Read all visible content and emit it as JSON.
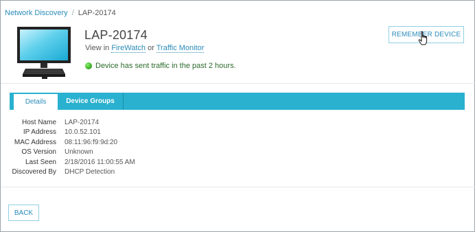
{
  "breadcrumb": {
    "parent": "Network Discovery",
    "separator": "/",
    "current": "LAP-20174"
  },
  "device": {
    "name": "LAP-20174",
    "icon": "monitor-icon",
    "view_in_prefix": "View in",
    "link_firewatch": "FireWatch",
    "or_text": "or",
    "link_traffic_monitor": "Traffic Monitor",
    "status_text": "Device has sent traffic in the past 2 hours.",
    "status_color": "#2fa51c"
  },
  "actions": {
    "remember_label": "REMEMBER DEVICE",
    "back_label": "BACK"
  },
  "tabs": [
    {
      "label": "Details",
      "active": true
    },
    {
      "label": "Device Groups",
      "active": false
    }
  ],
  "details": [
    {
      "label": "Host Name",
      "value": "LAP-20174"
    },
    {
      "label": "IP Address",
      "value": "10.0.52.101"
    },
    {
      "label": "MAC Address",
      "value": "08:11:96:f9:9d:20"
    },
    {
      "label": "OS Version",
      "value": "Unknown"
    },
    {
      "label": "Last Seen",
      "value": "2/18/2016 11:00:55 AM"
    },
    {
      "label": "Discovered By",
      "value": "DHCP Detection"
    }
  ],
  "colors": {
    "accent": "#29b1cf",
    "link": "#2a8bb8",
    "button_border": "#8fd0e3"
  }
}
